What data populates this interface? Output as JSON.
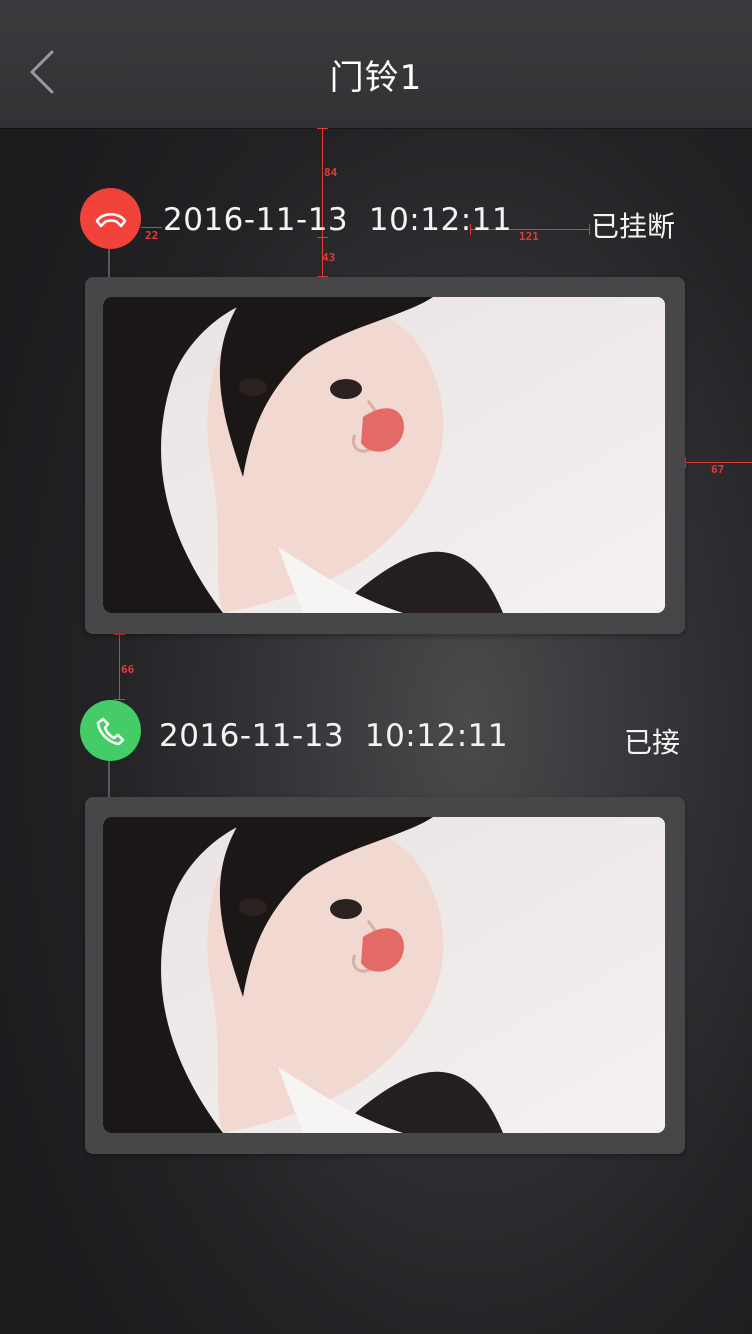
{
  "header": {
    "title": "门铃1"
  },
  "annotations": [
    "84",
    "22",
    "43",
    "121",
    "67",
    "66"
  ],
  "events": [
    {
      "time": "2016-11-13  10:12:11",
      "status": "已挂断",
      "icon": "hang-up-icon",
      "icon_color": "#f2433a"
    },
    {
      "time": "2016-11-13  10:12:11",
      "status": "已接",
      "icon": "phone-answered-icon",
      "icon_color": "#44cc66"
    }
  ]
}
